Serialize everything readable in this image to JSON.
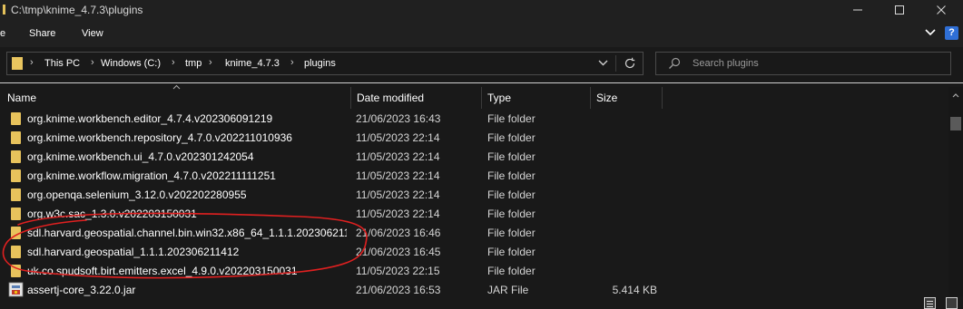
{
  "window": {
    "title": "C:\\tmp\\knime_4.7.3\\plugins",
    "minimize_icon": "minimize-icon",
    "maximize_icon": "maximize-icon",
    "close_icon": "close-icon"
  },
  "ribbon": {
    "tabs": [
      {
        "label": "e"
      },
      {
        "label": "Share"
      },
      {
        "label": "View"
      }
    ],
    "expand_icon": "chevron-down-icon",
    "help_label": "?"
  },
  "address": {
    "breadcrumbs": [
      "This PC",
      "Windows (C:)",
      "tmp",
      "knime_4.7.3",
      "plugins"
    ],
    "dropdown_icon": "chevron-down-icon",
    "refresh_icon": "refresh-icon"
  },
  "search": {
    "placeholder": "Search plugins",
    "icon": "search-icon"
  },
  "columns": {
    "name": "Name",
    "date": "Date modified",
    "type": "Type",
    "size": "Size"
  },
  "files": [
    {
      "name": "org.knime.workbench.editor_4.7.4.v202306091219",
      "date": "21/06/2023 16:43",
      "type": "File folder",
      "size": "",
      "icon": "folder-icon"
    },
    {
      "name": "org.knime.workbench.repository_4.7.0.v202211010936",
      "date": "11/05/2023 22:14",
      "type": "File folder",
      "size": "",
      "icon": "folder-icon"
    },
    {
      "name": "org.knime.workbench.ui_4.7.0.v202301242054",
      "date": "11/05/2023 22:14",
      "type": "File folder",
      "size": "",
      "icon": "folder-icon"
    },
    {
      "name": "org.knime.workflow.migration_4.7.0.v202211111251",
      "date": "11/05/2023 22:14",
      "type": "File folder",
      "size": "",
      "icon": "folder-icon"
    },
    {
      "name": "org.openqa.selenium_3.12.0.v202202280955",
      "date": "11/05/2023 22:14",
      "type": "File folder",
      "size": "",
      "icon": "folder-icon"
    },
    {
      "name": "org.w3c.sac_1.3.0.v202203150031",
      "date": "11/05/2023 22:14",
      "type": "File folder",
      "size": "",
      "icon": "folder-icon"
    },
    {
      "name": "sdl.harvard.geospatial.channel.bin.win32.x86_64_1.1.1.202306211...",
      "date": "21/06/2023 16:46",
      "type": "File folder",
      "size": "",
      "icon": "folder-icon"
    },
    {
      "name": "sdl.harvard.geospatial_1.1.1.202306211412",
      "date": "21/06/2023 16:45",
      "type": "File folder",
      "size": "",
      "icon": "folder-icon"
    },
    {
      "name": "uk.co.spudsoft.birt.emitters.excel_4.9.0.v202203150031",
      "date": "11/05/2023 22:15",
      "type": "File folder",
      "size": "",
      "icon": "folder-icon"
    },
    {
      "name": "assertj-core_3.22.0.jar",
      "date": "21/06/2023 16:53",
      "type": "JAR File",
      "size": "5.414 KB",
      "icon": "jar-file-icon"
    }
  ],
  "colors": {
    "background": "#191919",
    "folder": "#e8c35c",
    "annotation": "#e02020",
    "help": "#2f6fd6"
  }
}
